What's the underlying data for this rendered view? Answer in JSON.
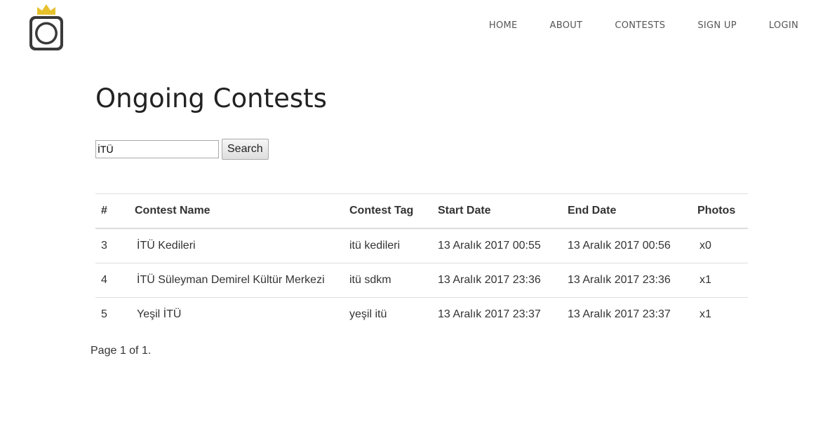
{
  "nav": {
    "items": [
      {
        "label": "HOME"
      },
      {
        "label": "ABOUT"
      },
      {
        "label": "CONTESTS"
      },
      {
        "label": "SIGN UP"
      },
      {
        "label": "LOGIN"
      }
    ]
  },
  "page": {
    "title": "Ongoing Contests"
  },
  "search": {
    "value": "İTÜ",
    "button_label": "Search"
  },
  "table": {
    "headers": [
      "#",
      "Contest Name",
      "Contest Tag",
      "Start Date",
      "End Date",
      "Photos"
    ],
    "rows": [
      {
        "num": "3",
        "name": "İTÜ Kedileri",
        "tag": "itü kedileri",
        "start": "13 Aralık 2017 00:55",
        "end": "13 Aralık 2017 00:56",
        "photos": "x0"
      },
      {
        "num": "4",
        "name": "İTÜ Süleyman Demirel Kültür Merkezi",
        "tag": "itü sdkm",
        "start": "13 Aralık 2017 23:36",
        "end": "13 Aralık 2017 23:36",
        "photos": "x1"
      },
      {
        "num": "5",
        "name": "Yeşil İTÜ",
        "tag": "yeşil itü",
        "start": "13 Aralık 2017 23:37",
        "end": "13 Aralık 2017 23:37",
        "photos": "x1"
      }
    ]
  },
  "pagination": {
    "text": "Page 1 of 1."
  },
  "colors": {
    "crown": "#e6c12c",
    "logo_frame": "#3a3a3a"
  },
  "logo": {
    "icon": "camera-crown-logo"
  }
}
